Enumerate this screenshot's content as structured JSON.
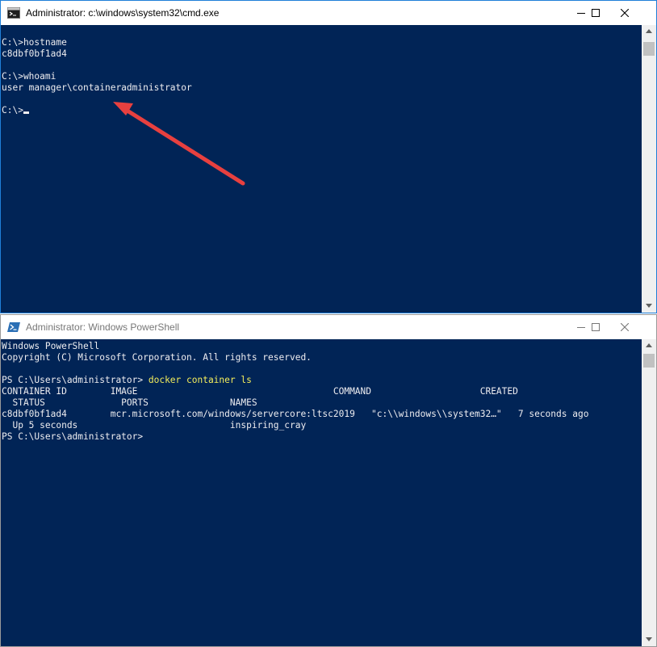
{
  "cmd": {
    "title": "Administrator: c:\\windows\\system32\\cmd.exe",
    "icon": "cmd-icon",
    "lines": [
      "C:\\>hostname",
      "c8dbf0bf1ad4",
      "",
      "C:\\>whoami",
      "user manager\\containeradministrator",
      "",
      "C:\\>"
    ],
    "annotation": {
      "type": "arrow",
      "color": "#e8403f"
    }
  },
  "powershell": {
    "title": "Administrator: Windows PowerShell",
    "icon": "powershell-icon",
    "lines": [
      "Windows PowerShell",
      "Copyright (C) Microsoft Corporation. All rights reserved.",
      "",
      "PS C:\\Users\\administrator> ",
      "CONTAINER ID        IMAGE                                    COMMAND                    CREATED",
      "  STATUS              PORTS               NAMES",
      "c8dbf0bf1ad4        mcr.microsoft.com/windows/servercore:ltsc2019   \"c:\\\\windows\\\\system32…\"   7 seconds ago",
      "  Up 5 seconds                            inspiring_cray",
      "PS C:\\Users\\administrator>"
    ],
    "command": "docker container ls"
  },
  "colors": {
    "console_bg": "#012456",
    "console_text": "#eeedf0",
    "command_text": "#f4ee5b",
    "annotation_arrow": "#e8403f",
    "active_border": "#1f7fd8"
  }
}
